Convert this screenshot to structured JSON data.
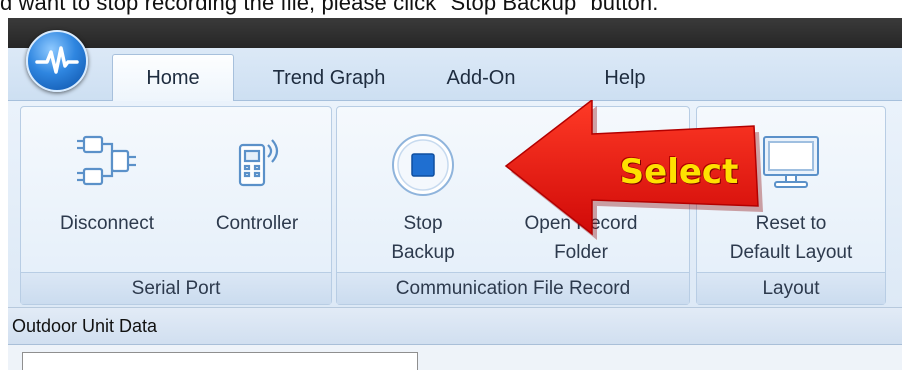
{
  "caption": "d want to stop recording the file, please click \"Stop Backup\" button.",
  "colors": {
    "accent": "#2f86e0",
    "annotation_red": "#e8110f",
    "annotation_text": "#ffe100",
    "ribbon_bg": "#eaf2fb"
  },
  "tabs": [
    {
      "label": "Home",
      "active": true
    },
    {
      "label": "Trend Graph",
      "active": false
    },
    {
      "label": "Add-On",
      "active": false
    },
    {
      "label": "Help",
      "active": false
    }
  ],
  "ribbon": {
    "serial_port": {
      "label": "Serial Port",
      "disconnect": {
        "label": "Disconnect",
        "icon": "plug-icon"
      },
      "controller": {
        "label": "Controller",
        "icon": "remote-controller-icon"
      }
    },
    "comm_file_record": {
      "label": "Communication File Record",
      "stop_backup": {
        "line1": "Stop",
        "line2": "Backup",
        "icon": "stop-icon"
      },
      "open_record_folder": {
        "line1": "Open Record",
        "line2": "Folder",
        "icon": "folder-icon"
      }
    },
    "layout": {
      "label": "Layout",
      "reset": {
        "line1": "Reset to",
        "line2": "Default Layout",
        "icon": "monitor-icon"
      }
    }
  },
  "panel": {
    "title": "Outdoor Unit Data"
  },
  "annotation": {
    "text": "Select"
  }
}
